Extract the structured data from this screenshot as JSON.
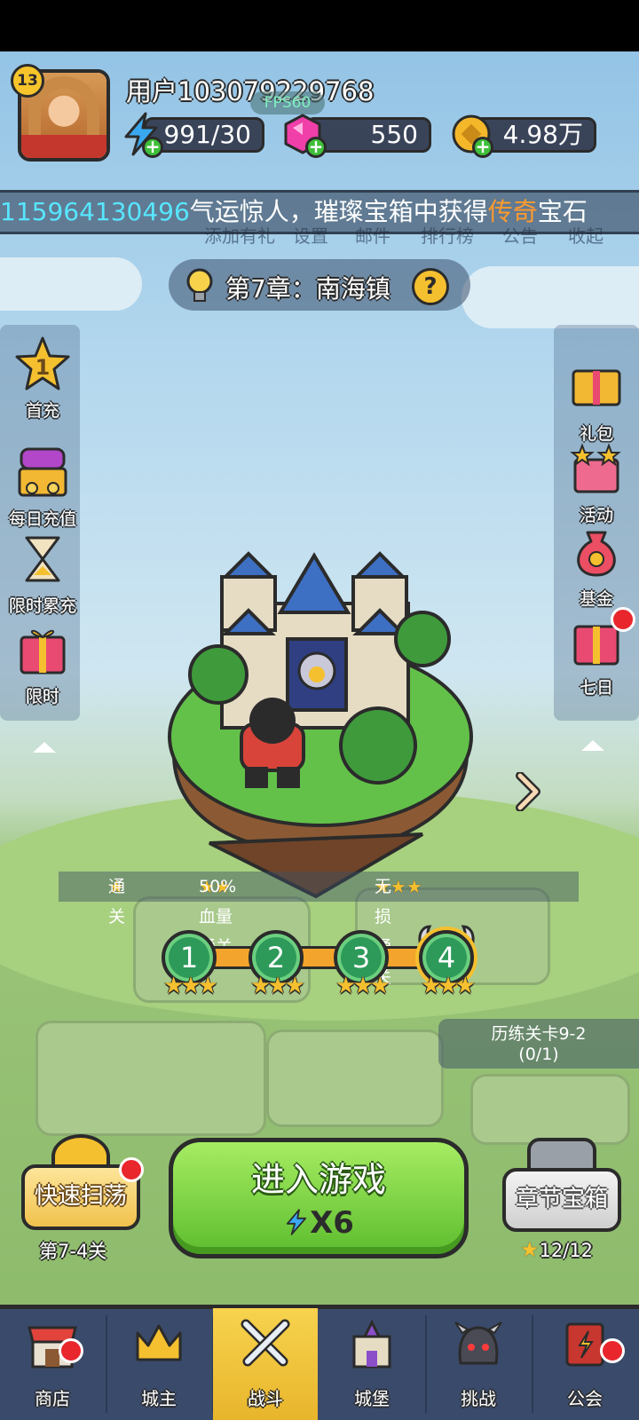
{
  "header": {
    "level": "13",
    "username": "用户103079229768",
    "fps": "FPS60",
    "energy": "991/30",
    "gems": "550",
    "gold": "4.98万"
  },
  "ticker": {
    "player_id": "115964130496",
    "message": "气运惊人，璀璨宝箱中获得",
    "highlight": "传奇",
    "suffix": "宝石"
  },
  "top_menu_ghost": [
    "添加有礼",
    "设置",
    "邮件",
    "排行榜",
    "公告",
    "收起"
  ],
  "chapter": {
    "title": "第7章：南海镇",
    "help": "?"
  },
  "left_sidebar": [
    {
      "label": "首充",
      "icon": "star-1-icon"
    },
    {
      "label": "每日充值",
      "icon": "treasure-chest-icon"
    },
    {
      "label": "限时累充",
      "icon": "hourglass-icon"
    },
    {
      "label": "限时",
      "icon": "gift-box-icon"
    }
  ],
  "right_sidebar": [
    {
      "label": "礼包",
      "icon": "gift-pack-icon",
      "alert": false
    },
    {
      "label": "活动",
      "icon": "event-gift-icon",
      "alert": false
    },
    {
      "label": "基金",
      "icon": "money-bag-icon",
      "alert": false
    },
    {
      "label": "七日",
      "icon": "seven-day-gift-icon",
      "alert": true
    }
  ],
  "star_legend": {
    "one": "通关",
    "two": "50%血量通关",
    "three": "无损通关"
  },
  "stages": [
    {
      "num": "1",
      "stars": "★★★"
    },
    {
      "num": "2",
      "stars": "★★★"
    },
    {
      "num": "3",
      "stars": "★★★"
    },
    {
      "num": "4",
      "stars": "★★★",
      "current": true
    }
  ],
  "trial": {
    "title": "历练关卡9-2",
    "progress": "(0/1)"
  },
  "actions": {
    "sweep_label": "快速扫荡",
    "sweep_sub": "第7-4关",
    "enter_label": "进入游戏",
    "enter_cost": "X6",
    "chest_label": "章节宝箱",
    "chest_sub": "12/12"
  },
  "nav": [
    {
      "label": "商店",
      "icon": "shop-icon",
      "alert": true
    },
    {
      "label": "城主",
      "icon": "crown-icon",
      "alert": false
    },
    {
      "label": "战斗",
      "icon": "crossed-swords-icon",
      "alert": false,
      "active": true
    },
    {
      "label": "城堡",
      "icon": "castle-icon",
      "alert": false
    },
    {
      "label": "挑战",
      "icon": "demon-helmet-icon",
      "alert": false
    },
    {
      "label": "公会",
      "icon": "guild-banner-icon",
      "alert": true
    }
  ],
  "colors": {
    "accent_green": "#5dbd2e",
    "gold": "#f5c02f",
    "alert_red": "#e8262c",
    "ticker_id": "#58e6ff",
    "ticker_highlight": "#ff9a2e"
  }
}
